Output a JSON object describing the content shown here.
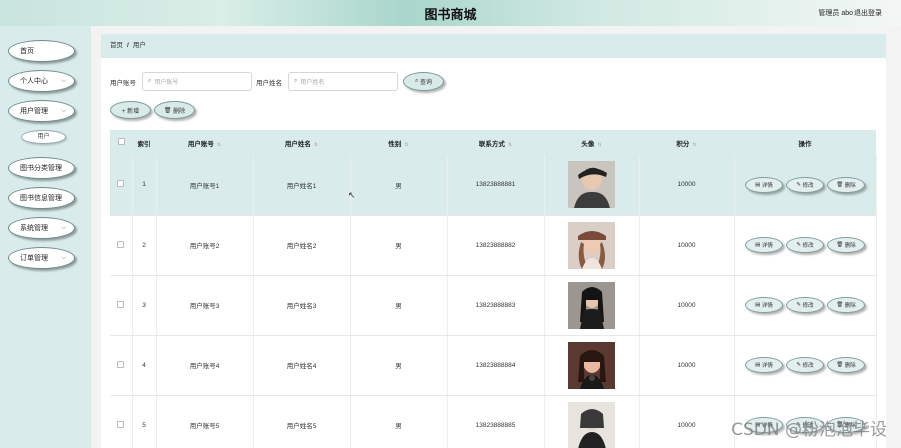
{
  "header": {
    "title": "图书商城",
    "user": "管理员 abo",
    "logout": "退出登录"
  },
  "sidebar": {
    "items": [
      {
        "label": "首页",
        "chevron": false
      },
      {
        "label": "个人中心",
        "chevron": true
      },
      {
        "label": "用户管理",
        "chevron": true
      },
      {
        "label": "图书分类管理",
        "chevron": false
      },
      {
        "label": "图书信息管理",
        "chevron": false
      },
      {
        "label": "系统管理",
        "chevron": true
      },
      {
        "label": "订单管理",
        "chevron": true
      }
    ],
    "sub_item": "用户"
  },
  "breadcrumb": {
    "home": "首页",
    "separator": "/",
    "current": "用户"
  },
  "search": {
    "account_label": "用户账号",
    "account_placeholder": "用户账号",
    "name_label": "用户姓名",
    "name_placeholder": "用户姓名",
    "query_button": "查询"
  },
  "actions": {
    "add": "+ 新增",
    "delete": "删除"
  },
  "table": {
    "columns": [
      "索引",
      "用户账号",
      "用户姓名",
      "性别",
      "联系方式",
      "头像",
      "积分",
      "操作"
    ],
    "rows": [
      {
        "index": "1",
        "account": "用户账号1",
        "name": "用户姓名1",
        "gender": "男",
        "phone": "13823888881",
        "points": "10000"
      },
      {
        "index": "2",
        "account": "用户账号2",
        "name": "用户姓名2",
        "gender": "男",
        "phone": "13823888882",
        "points": "10000"
      },
      {
        "index": "3",
        "account": "用户账号3",
        "name": "用户姓名3",
        "gender": "男",
        "phone": "13823888883",
        "points": "10000"
      },
      {
        "index": "4",
        "account": "用户账号4",
        "name": "用户姓名4",
        "gender": "男",
        "phone": "13823888884",
        "points": "10000"
      },
      {
        "index": "5",
        "account": "用户账号5",
        "name": "用户姓名5",
        "gender": "男",
        "phone": "13823888885",
        "points": "10000"
      }
    ],
    "row_actions": {
      "detail": "详情",
      "edit": "修改",
      "delete": "删除"
    }
  },
  "watermark": "CSDN @粉泡泡毕设",
  "colors": {
    "accent_bg": "#d9eceb",
    "sidebar_bg": "#d9eceb"
  }
}
